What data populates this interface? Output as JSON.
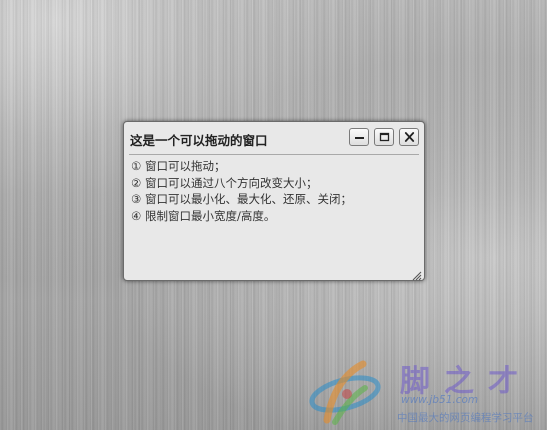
{
  "window": {
    "title": "这是一个可以拖动的窗口",
    "controls": {
      "minimize_icon": "minimize-icon",
      "maximize_icon": "maximize-icon",
      "close_icon": "close-icon"
    },
    "features": [
      "① 窗口可以拖动；",
      "② 窗口可以通过八个方向改变大小；",
      "③ 窗口可以最小化、最大化、还原、关闭；",
      "④ 限制窗口最小宽度/高度。"
    ]
  },
  "watermark": {
    "brand": "脚之才",
    "url": "www.jb51.com",
    "tagline": "中国最大的网页编程学习平台"
  },
  "colors": {
    "window_bg": "#e8e8e8",
    "window_border": "#6b6b6b",
    "text": "#333333",
    "watermark_purple": "#6e5ac8",
    "watermark_blue": "#3c6ec8"
  }
}
